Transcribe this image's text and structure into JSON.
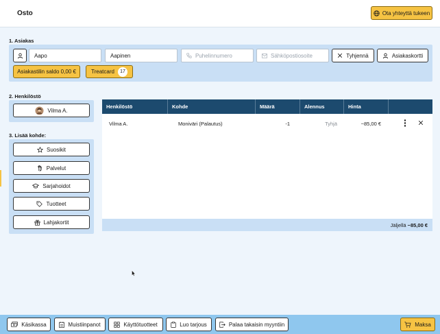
{
  "header": {
    "title": "Osto",
    "support_label": "Ota yhteyttä tukeen"
  },
  "customer": {
    "section_label": "1. Asiakas",
    "first_name": "Aapo",
    "last_name": "Aapinen",
    "phone_placeholder": "Puhelinnumero",
    "email_placeholder": "Sähköpostiosoite",
    "clear_label": "Tyhjennä",
    "card_label": "Asiakaskortti",
    "balance_label": "Asiakastilin saldo 0,00 €",
    "treatcard_label": "Treatcard",
    "treatcard_count": "17"
  },
  "staff": {
    "section_label": "2. Henkilöstö",
    "selected": "Vilma A."
  },
  "add_item": {
    "section_label": "3. Lisää kohde:",
    "buttons": [
      {
        "label": "Suosikit",
        "icon": "star-icon"
      },
      {
        "label": "Palvelut",
        "icon": "hand-icon"
      },
      {
        "label": "Sarjahoidot",
        "icon": "graduation-cap-icon"
      },
      {
        "label": "Tuotteet",
        "icon": "tag-icon"
      },
      {
        "label": "Lahjakortit",
        "icon": "gift-icon"
      }
    ]
  },
  "table": {
    "headers": [
      "Henkilöstö",
      "Kohde",
      "Määrä",
      "Alennus",
      "Hinta"
    ],
    "rows": [
      {
        "staff": "Vilma A.",
        "item": "Moniväri (Palautus)",
        "qty": "-1",
        "discount": "Tyhjä",
        "price": "−85,00 €"
      }
    ],
    "remaining_label": "Jäljellä",
    "remaining_value": "−85,00 €"
  },
  "footer": {
    "buttons": [
      {
        "label": "Käsikassa",
        "icon": "cash-icon"
      },
      {
        "label": "Muistiinpanot",
        "icon": "notes-icon"
      },
      {
        "label": "Käyttötuotteet",
        "icon": "grid-icon"
      },
      {
        "label": "Luo tarjous",
        "icon": "clipboard-icon"
      },
      {
        "label": "Palaa takaisin myyntiin",
        "icon": "exit-icon"
      }
    ],
    "pay_label": "Maksa"
  },
  "colors": {
    "accent": "#f6c343",
    "header_dark": "#1c4a6e",
    "panel": "#c9dff5",
    "bottombar": "#8fc7ee"
  }
}
